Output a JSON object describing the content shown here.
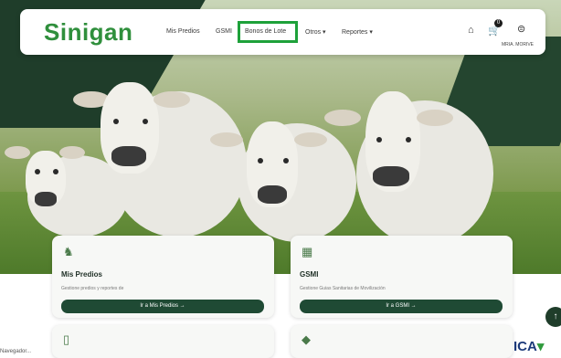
{
  "navbar": {
    "logo": "Sinigan",
    "items": [
      "Mis Predios",
      "GSMI",
      "Bonos de Lote",
      "Otros ▾",
      "Reportes ▾"
    ],
    "cart_count": "0",
    "user_name": "MRIA. MORIVE"
  },
  "cards": [
    {
      "title": "Mis Predios",
      "desc": "Gestione predios y reportes de",
      "button": "Ir a Mis Predios  →",
      "icon": "livestock-icon"
    },
    {
      "title": "GSMI",
      "desc": "Gestione Guias Sanitarias de Movilización",
      "button": "Ir a GSMI  →",
      "icon": "qr-icon"
    }
  ],
  "footer": {
    "ica_logo": "ICA",
    "bottom_label": "Navegador..."
  }
}
